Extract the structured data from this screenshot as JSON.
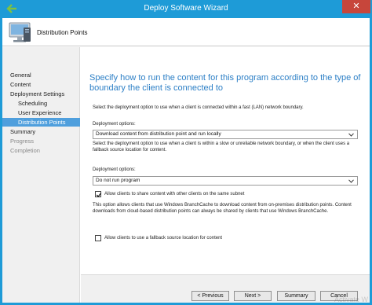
{
  "window": {
    "title": "Deploy Software Wizard",
    "close_glyph": "✕"
  },
  "header": {
    "title": "Distribution Points",
    "icon": "computer-wizard-icon"
  },
  "sidebar": {
    "items": [
      {
        "label": "General",
        "state": "normal",
        "level": 0
      },
      {
        "label": "Content",
        "state": "normal",
        "level": 0
      },
      {
        "label": "Deployment Settings",
        "state": "normal",
        "level": 0
      },
      {
        "label": "Scheduling",
        "state": "normal",
        "level": 1
      },
      {
        "label": "User Experience",
        "state": "normal",
        "level": 1
      },
      {
        "label": "Distribution Points",
        "state": "active",
        "level": 1
      },
      {
        "label": "Summary",
        "state": "normal",
        "level": 0
      },
      {
        "label": "Progress",
        "state": "disabled",
        "level": 0
      },
      {
        "label": "Completion",
        "state": "disabled",
        "level": 0
      }
    ]
  },
  "main": {
    "heading": "Specify how to run the content for this program according to the type of boundary the client is connected to",
    "fast_intro": "Select the deployment option to use when a client is connected within a fast (LAN) network boundary.",
    "options_label_1": "Deployment options:",
    "select_1_value": "Download content from distribution point and run locally",
    "slow_intro": "Select the deployment option to use when a client is within a slow or unreliable network boundary, or when the client uses a fallback source location for content.",
    "options_label_2": "Deployment options:",
    "select_2_value": "Do not run program",
    "share_checkbox": {
      "label": "Allow clients to share content with other clients on the same subnet",
      "checked": true
    },
    "branchcache_text": "This option allows clients that use Windows BranchCache to download content from on-premises distribution points. Content downloads from cloud-based distribution points can always be shared by clients that use Windows BranchCache.",
    "fallback_checkbox": {
      "label": "Allow clients to use a fallback source location for content",
      "checked": false
    }
  },
  "footer": {
    "previous": "< Previous",
    "next": "Next >",
    "summary": "Summary",
    "cancel": "Cancel"
  },
  "watermark": "Activate W",
  "colors": {
    "titlebar": "#1e9bd7",
    "accent_heading": "#2c7fc6",
    "active_nav": "#4f9fdd",
    "close": "#c7463b"
  }
}
